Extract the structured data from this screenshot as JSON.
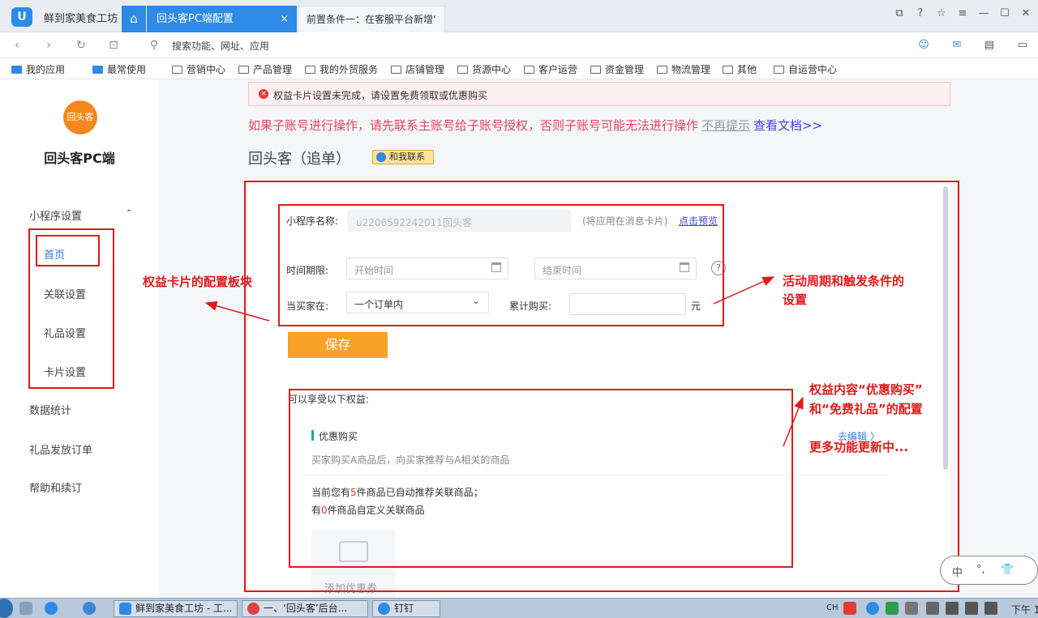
{
  "app": {
    "name": "鲜到家美食工坊",
    "tabs": [
      {
        "label": "回头客PC端配置",
        "close": "×"
      },
      {
        "label": "前置条件一：在客服平台新增‘"
      }
    ]
  },
  "address_bar": {
    "placeholder": "搜索功能、网址、应用"
  },
  "bookmarks": [
    "我的应用",
    "最常使用",
    "营销中心",
    "产品管理",
    "我的外贸服务",
    "店铺管理",
    "货源中心",
    "客户运营",
    "资金管理",
    "物流管理",
    "其他",
    "自运营中心"
  ],
  "sidebar": {
    "brand_logo_text": "回头客",
    "brand_name": "回头客PC端",
    "group": "小程序设置",
    "group_arrow": "⌃",
    "sub_items": [
      "首页",
      "关联设置",
      "礼品设置",
      "卡片设置"
    ],
    "items": [
      "数据统计",
      "礼品发放订单",
      "帮助和续订"
    ]
  },
  "alert": {
    "icon": "×",
    "text": "权益卡片设置未完成，请设置免费领取或优惠购买"
  },
  "warning": {
    "text": "如果子账号进行操作，请先联系主账号给子账号授权，否则子账号可能无法进行操作",
    "no_show": "不再提示",
    "doc_link": "查看文档>>"
  },
  "page": {
    "title": "回头客（追单）",
    "contact_button": "和我联系"
  },
  "form": {
    "miniapp_label": "小程序名称:",
    "miniapp_value": "u2206592242011回头客",
    "miniapp_hint": "(将应用在消息卡片)",
    "miniapp_preview": "点击预览",
    "time_label": "时间期限:",
    "start_placeholder": "开始时间",
    "end_placeholder": "结束时间",
    "help": "?",
    "buyer_label": "当买家在:",
    "buyer_select": "一个订单内",
    "cumulative_label": "累计购买:",
    "cumulative_value": "",
    "unit": "元",
    "save": "保存"
  },
  "benefits": {
    "title": "可以享受以下权益:",
    "card_name": "优惠购买",
    "card_desc": "买家购买A商品后，向买家推荐与A相关的商品",
    "edit": "去编辑 〉",
    "line1_before": "当前您有",
    "line1_num": "5",
    "line1_after": "件商品已自动推荐关联商品；",
    "line2_before": "有",
    "line2_num": "0",
    "line2_after": "件商品自定义关联商品",
    "add_coupon": "添加优惠券"
  },
  "annotations": {
    "left": "权益卡片的配置板块",
    "right_line1": "活动周期和触发条件的",
    "right_line2": "设置",
    "bottom_line1": "权益内容“优惠购买”",
    "bottom_line2": "和“免费礼品”的配置",
    "bottom_line3": "更多功能更新中..."
  },
  "ime": {
    "lang": "中",
    "punct": "°,",
    "shirt": "👕"
  },
  "taskbar": {
    "tasks": [
      "鲜到家美食工坊 - 工...",
      "一、‘回头客’后台...",
      "钉钉"
    ],
    "lang": "CH",
    "time": "下午 1"
  },
  "colors": {
    "accent": "#2d8ae6",
    "save": "#f6a225",
    "annotation": "#e01a1a",
    "warning": "#e8435f",
    "brand": "#f5871f"
  }
}
